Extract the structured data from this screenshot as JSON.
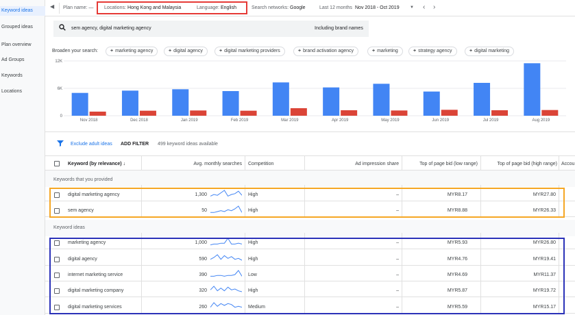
{
  "sidebar": {
    "items": [
      {
        "label": "Keyword ideas",
        "active": true
      },
      {
        "label": "Grouped ideas"
      },
      {
        "label": "Plan overview"
      },
      {
        "label": "Ad Groups"
      },
      {
        "label": "Keywords"
      },
      {
        "label": "Locations"
      }
    ]
  },
  "topbar": {
    "plan_name": "Plan name: —",
    "locations_label": "Locations:",
    "locations_value": "Hong Kong and Malaysia",
    "language_label": "Language:",
    "language_value": "English",
    "networks_label": "Search networks:",
    "networks_value": "Google",
    "range_label": "Last 12 months",
    "range_value": "Nov 2018 - Oct 2019"
  },
  "search": {
    "query": "sem agency, digital marketing agency",
    "brand_names": "Including brand names"
  },
  "broaden": {
    "label": "Broaden your search:",
    "chips": [
      "marketing agency",
      "digital agency",
      "digital marketing providers",
      "brand activation agency",
      "marketing",
      "strategy agency",
      "digital marketing"
    ]
  },
  "filter": {
    "exclude": "Exclude adult ideas",
    "add_filter": "ADD FILTER",
    "count": "499 keyword ideas available"
  },
  "table": {
    "headers": {
      "keyword": "Keyword (by relevance)",
      "searches": "Avg. monthly searches",
      "competition": "Competition",
      "impression": "Ad impression share",
      "low": "Top of page bid (low range)",
      "high": "Top of page bid (high range)",
      "account": "Accou"
    },
    "section_provided": "Keywords that you provided",
    "section_ideas": "Keyword ideas",
    "provided": [
      {
        "keyword": "digital marketing agency",
        "searches": "1,300",
        "competition": "High",
        "impression": "–",
        "low": "MYR8.17",
        "high": "MYR27.80"
      },
      {
        "keyword": "sem agency",
        "searches": "50",
        "competition": "High",
        "impression": "–",
        "low": "MYR8.88",
        "high": "MYR26.33"
      }
    ],
    "ideas": [
      {
        "keyword": "marketing agency",
        "searches": "1,000",
        "competition": "High",
        "impression": "–",
        "low": "MYR5.93",
        "high": "MYR26.80"
      },
      {
        "keyword": "digital agency",
        "searches": "590",
        "competition": "High",
        "impression": "–",
        "low": "MYR4.76",
        "high": "MYR19.41"
      },
      {
        "keyword": "internet marketing service",
        "searches": "390",
        "competition": "Low",
        "impression": "–",
        "low": "MYR4.69",
        "high": "MYR11.37"
      },
      {
        "keyword": "digital marketing company",
        "searches": "320",
        "competition": "High",
        "impression": "–",
        "low": "MYR5.87",
        "high": "MYR19.72"
      },
      {
        "keyword": "digital marketing services",
        "searches": "260",
        "competition": "Medium",
        "impression": "–",
        "low": "MYR5.59",
        "high": "MYR15.17"
      }
    ]
  },
  "colors": {
    "blue": "#4285f4",
    "red": "#db4437",
    "accent": "#1a73e8",
    "orange_frame": "#f5a623",
    "blue_frame": "#2a31b8",
    "red_frame": "#e53935"
  },
  "chart_data": {
    "type": "bar",
    "categories": [
      "Nov 2018",
      "Dec 2018",
      "Jan 2019",
      "Feb 2019",
      "Mar 2019",
      "Apr 2019",
      "May 2019",
      "Jun 2019",
      "Jul 2019",
      "Aug 2019"
    ],
    "series": [
      {
        "values": [
          5000,
          5500,
          5800,
          5400,
          7300,
          6200,
          7000,
          5300,
          7200,
          11500
        ]
      },
      {
        "values": [
          900,
          1100,
          1150,
          1100,
          1650,
          1200,
          1150,
          1300,
          1200,
          1250
        ]
      }
    ],
    "y_ticks": [
      "12K",
      "6K",
      "0"
    ],
    "ylim": [
      0,
      12000
    ],
    "grid": true
  }
}
